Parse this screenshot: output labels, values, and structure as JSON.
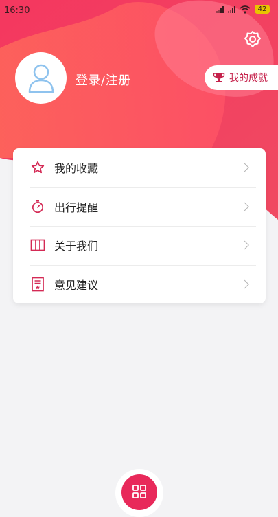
{
  "status_bar": {
    "time": "16:30",
    "battery": "42",
    "icons": [
      "signal-icon",
      "signal-icon",
      "wifi-icon",
      "battery-icon"
    ]
  },
  "header": {
    "settings_icon": "gear-icon",
    "login_label": "登录/注册",
    "achievement_label": "我的成就",
    "achievement_icon": "trophy-icon",
    "accent_color": "#e8295a"
  },
  "menu": {
    "items": [
      {
        "label": "我的收藏",
        "icon": "star-icon"
      },
      {
        "label": "出行提醒",
        "icon": "stopwatch-icon"
      },
      {
        "label": "关于我们",
        "icon": "book-icon"
      },
      {
        "label": "意见建议",
        "icon": "feedback-icon"
      }
    ]
  },
  "bottom": {
    "fab_icon": "grid-icon"
  }
}
